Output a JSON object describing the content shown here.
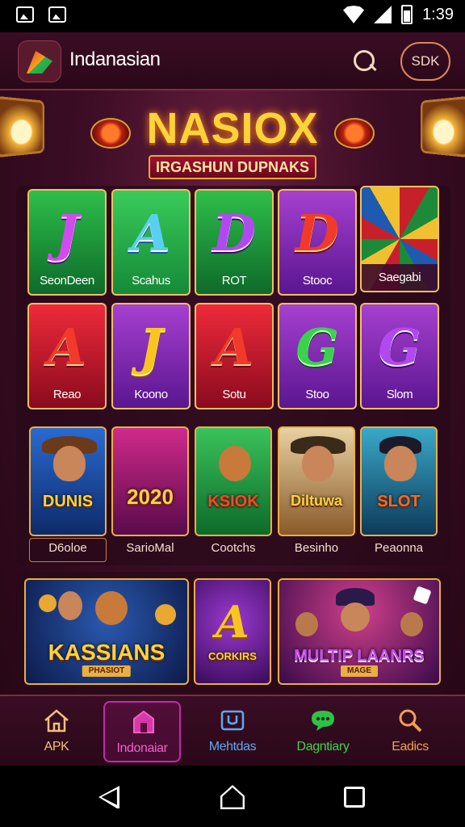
{
  "status_bar": {
    "time": "1:39",
    "icons": [
      "image-icon",
      "media-icon",
      "wifi-icon",
      "signal-icon",
      "battery-icon"
    ]
  },
  "app_bar": {
    "title": "Indanasian",
    "search_icon": "search-icon",
    "sdk_label": "SDK"
  },
  "banner": {
    "title": "NASIOX",
    "subtitle": "IRGASHUN DUPNAKS"
  },
  "game_grid": {
    "rows": [
      [
        {
          "glyph": "J",
          "label": "SeonDeen",
          "style": "green"
        },
        {
          "glyph": "A",
          "label": "Scahus",
          "style": "green2"
        },
        {
          "glyph": "D",
          "label": "ROT",
          "style": "green"
        },
        {
          "glyph": "D",
          "label": "Stooc",
          "style": "purple"
        },
        {
          "glyph": "",
          "label": "Saegabi",
          "style": "roulette"
        }
      ],
      [
        {
          "glyph": "A",
          "label": "Reao",
          "style": "red"
        },
        {
          "glyph": "J",
          "label": "Koono",
          "style": "purple"
        },
        {
          "glyph": "A",
          "label": "Sotu",
          "style": "red"
        },
        {
          "glyph": "G",
          "label": "Stoo",
          "style": "purple"
        },
        {
          "glyph": "G",
          "label": "Slom",
          "style": "purple"
        }
      ]
    ]
  },
  "featured": [
    {
      "art_text": "DUNIS",
      "label": "D6oloe"
    },
    {
      "art_text": "2020",
      "label": "SarioMal"
    },
    {
      "art_text": "KSIOK",
      "label": "Cootchs"
    },
    {
      "art_text": "Diltuwa",
      "label": "Besinho"
    },
    {
      "art_text": "SLOT",
      "label": "Peaonna"
    }
  ],
  "promos": [
    {
      "title": "KASSIANS",
      "sub": "PHASIOT"
    },
    {
      "title": "CORKIRS",
      "sub": ""
    },
    {
      "title": "MULTIP LAANRS",
      "sub": "MAGE"
    }
  ],
  "bottom_nav": [
    {
      "label": "APK",
      "icon": "home-outline-icon",
      "color": "#f0c080"
    },
    {
      "label": "Indonaiar",
      "icon": "shop-icon",
      "color": "#f060c8",
      "active": true
    },
    {
      "label": "Mehtdas",
      "icon": "device-icon",
      "color": "#60a8f0"
    },
    {
      "label": "Dagntiary",
      "icon": "chat-icon",
      "color": "#40d050"
    },
    {
      "label": "Eadics",
      "icon": "search-icon",
      "color": "#f0a050"
    }
  ],
  "colors": {
    "background": "#3d0d26",
    "accent_gold": "#ffd23a",
    "active_nav": "#c02ab0"
  }
}
